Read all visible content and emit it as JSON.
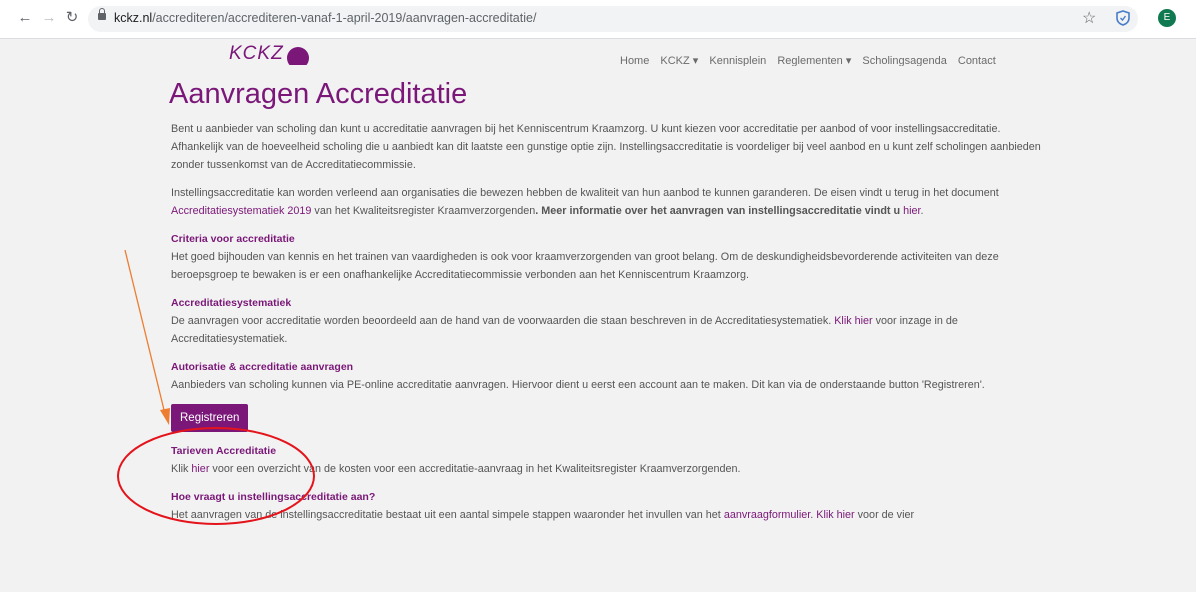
{
  "browser": {
    "url_domain": "kckz.nl",
    "url_path": "/accrediteren/accrediteren-vanaf-1-april-2019/aanvragen-accreditatie/",
    "profile_initial": "E",
    "back_icon": "arrow-left-icon",
    "forward_icon": "arrow-right-icon",
    "reload_icon": "reload-icon"
  },
  "site": {
    "logo_text": "KCKZ",
    "nav": [
      "Home",
      "KCKZ ▾",
      "Kennisplein",
      "Reglementen ▾",
      "Scholingsagenda",
      "Contact"
    ]
  },
  "page": {
    "title": "Aanvragen Accreditatie",
    "intro": "Bent u aanbieder van scholing dan kunt u accreditatie aanvragen bij het Kenniscentrum Kraamzorg. U kunt kiezen voor accreditatie per aanbod of voor instellingsaccreditatie. Afhankelijk van de hoeveelheid scholing die u aanbiedt kan dit laatste een gunstige optie zijn. Instellingsaccreditatie is voordeliger bij veel aanbod en u kunt zelf scholingen aanbieden zonder tussenkomst van de Accreditatiecommissie.",
    "p2_a": "Instellingsaccreditatie kan worden verleend aan organisaties die bewezen hebben de kwaliteit van hun aanbod te kunnen garanderen. De eisen vindt u terug in het document ",
    "p2_link": "Accreditatiesystematiek 2019",
    "p2_b": " van het Kwaliteitsregister Kraamverzorgenden",
    "p2_c": ". Meer informatie over het aanvragen van instellingsaccreditatie vindt u ",
    "p2_link2": "hier",
    "p2_end": ".",
    "criteria_heading": "Criteria voor accreditatie",
    "criteria_text": "Het goed bijhouden van kennis en het trainen van vaardigheden is ook voor kraamverzorgenden van groot belang. Om de deskundigheidsbevorderende activiteiten van deze beroepsgroep te bewaken is er een onafhankelijke Accreditatiecommissie verbonden aan het Kenniscentrum Kraamzorg.",
    "system_heading": "Accreditatiesystematiek",
    "system_text_a": "De aanvragen voor accreditatie worden beoordeeld aan de hand van de voorwaarden die staan beschreven in de Accreditatiesystematiek. ",
    "system_link": "Klik hier",
    "system_text_b": " voor inzage in de Accreditatiesystematiek.",
    "auth_heading": "Autorisatie & accreditatie aanvragen",
    "auth_text": "Aanbieders van scholing kunnen via PE-online accreditatie aanvragen. Hiervoor dient u eerst een account aan te maken. Dit kan via de onderstaande button 'Registreren'.",
    "register_button": "Registreren",
    "fees_heading": "Tarieven Accreditatie",
    "fees_a": "Klik ",
    "fees_link": "hier",
    "fees_b": " voor een overzicht van de kosten voor een accreditatie-aanvraag in het Kwaliteitsregister Kraamverzorgenden.",
    "how_heading": "Hoe vraagt u instellingsaccreditatie aan?",
    "how_a": "Het aanvragen van de instellingsaccreditatie bestaat uit een aantal simpele stappen waaronder het invullen van het ",
    "how_link": "aanvraagformulier",
    "how_b": ". ",
    "how_link2": "Klik hier",
    "how_c": " voor de vier"
  },
  "colors": {
    "brand_purple": "#7a1778",
    "annotation_red": "#e3141b",
    "annotation_orange": "#ed7d31"
  }
}
